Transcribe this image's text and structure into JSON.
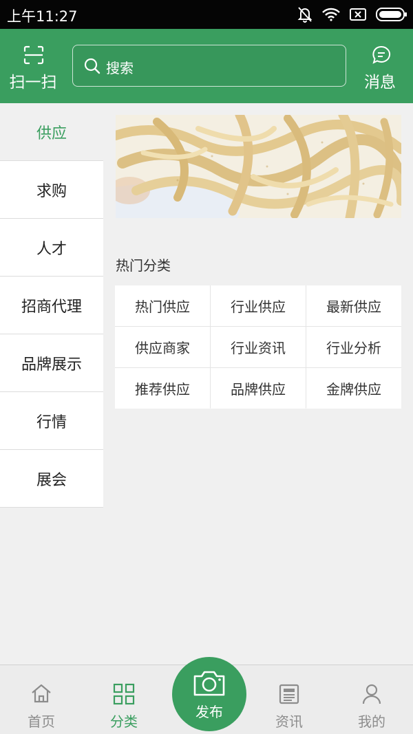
{
  "status_bar": {
    "time": "上午11:27"
  },
  "header": {
    "scan_label": "扫一扫",
    "search_placeholder": "搜索",
    "message_label": "消息"
  },
  "sidebar": {
    "items": [
      {
        "label": "供应",
        "active": true
      },
      {
        "label": "求购"
      },
      {
        "label": "人才"
      },
      {
        "label": "招商代理"
      },
      {
        "label": "品牌展示"
      },
      {
        "label": "行情"
      },
      {
        "label": "展会"
      }
    ]
  },
  "main": {
    "section_title": "热门分类",
    "categories": [
      "热门供应",
      "行业供应",
      "最新供应",
      "供应商家",
      "行业资讯",
      "行业分析",
      "推荐供应",
      "品牌供应",
      "金牌供应"
    ]
  },
  "bottom_nav": {
    "tabs": [
      {
        "label": "首页",
        "icon": "home-icon"
      },
      {
        "label": "分类",
        "icon": "grid-icon",
        "active": true
      },
      {
        "label": "资讯",
        "icon": "news-icon"
      },
      {
        "label": "我的",
        "icon": "user-icon"
      }
    ],
    "publish_label": "发布",
    "publish_icon": "camera-icon"
  },
  "colors": {
    "brand_green": "#3a9e5f",
    "status_bar": "#050505",
    "background": "#f0f0f0"
  }
}
